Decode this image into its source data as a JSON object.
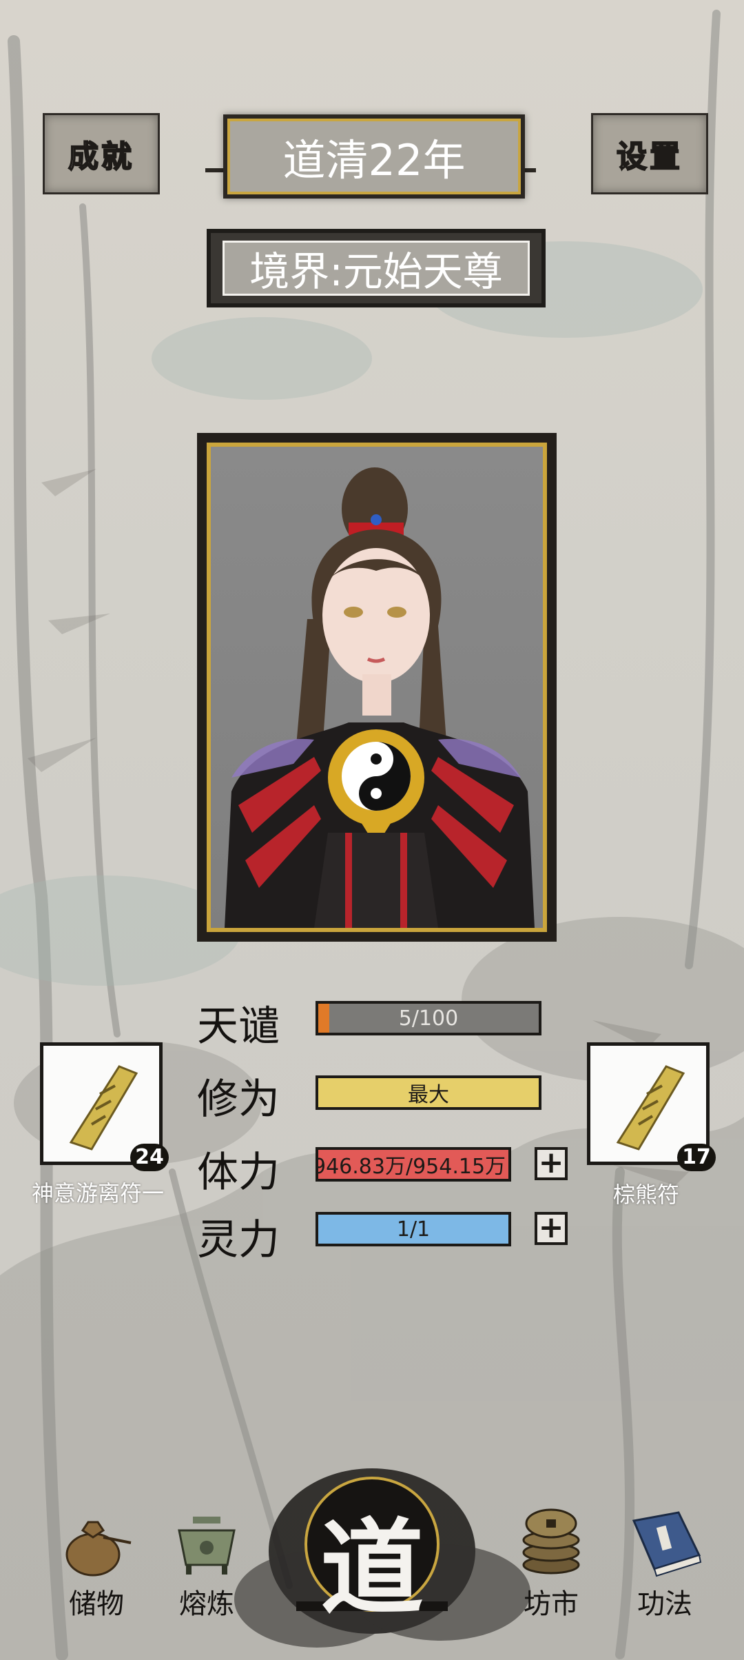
{
  "header": {
    "achievement_label": "成就",
    "settings_label": "设置",
    "year_title": "道清22年",
    "realm": "境界:元始天尊"
  },
  "stats": [
    {
      "label": "天谴",
      "value_text": "5/100",
      "fill_fraction": 0.05,
      "color": "#e07a28"
    },
    {
      "label": "修为",
      "value_text": "最大",
      "fill_fraction": 1.0,
      "color": "#e6cf6a"
    },
    {
      "label": "体力",
      "value_text": "946.83万/954.15万",
      "fill_fraction": 0.99,
      "color": "#e25a57"
    },
    {
      "label": "灵力",
      "value_text": "1/1",
      "fill_fraction": 1.0,
      "color": "#7db8e6"
    }
  ],
  "talismans": {
    "left": {
      "name": "神意游离符一",
      "count": "24",
      "icon": "talisman-icon"
    },
    "right": {
      "name": "棕熊符",
      "count": "17",
      "icon": "talisman-icon"
    }
  },
  "nav": {
    "storage": "储物",
    "smelt": "熔炼",
    "dao": "道",
    "market": "坊市",
    "skills": "功法"
  },
  "colors": {
    "gold": "#caa53c",
    "ink": "#1c1a17"
  }
}
